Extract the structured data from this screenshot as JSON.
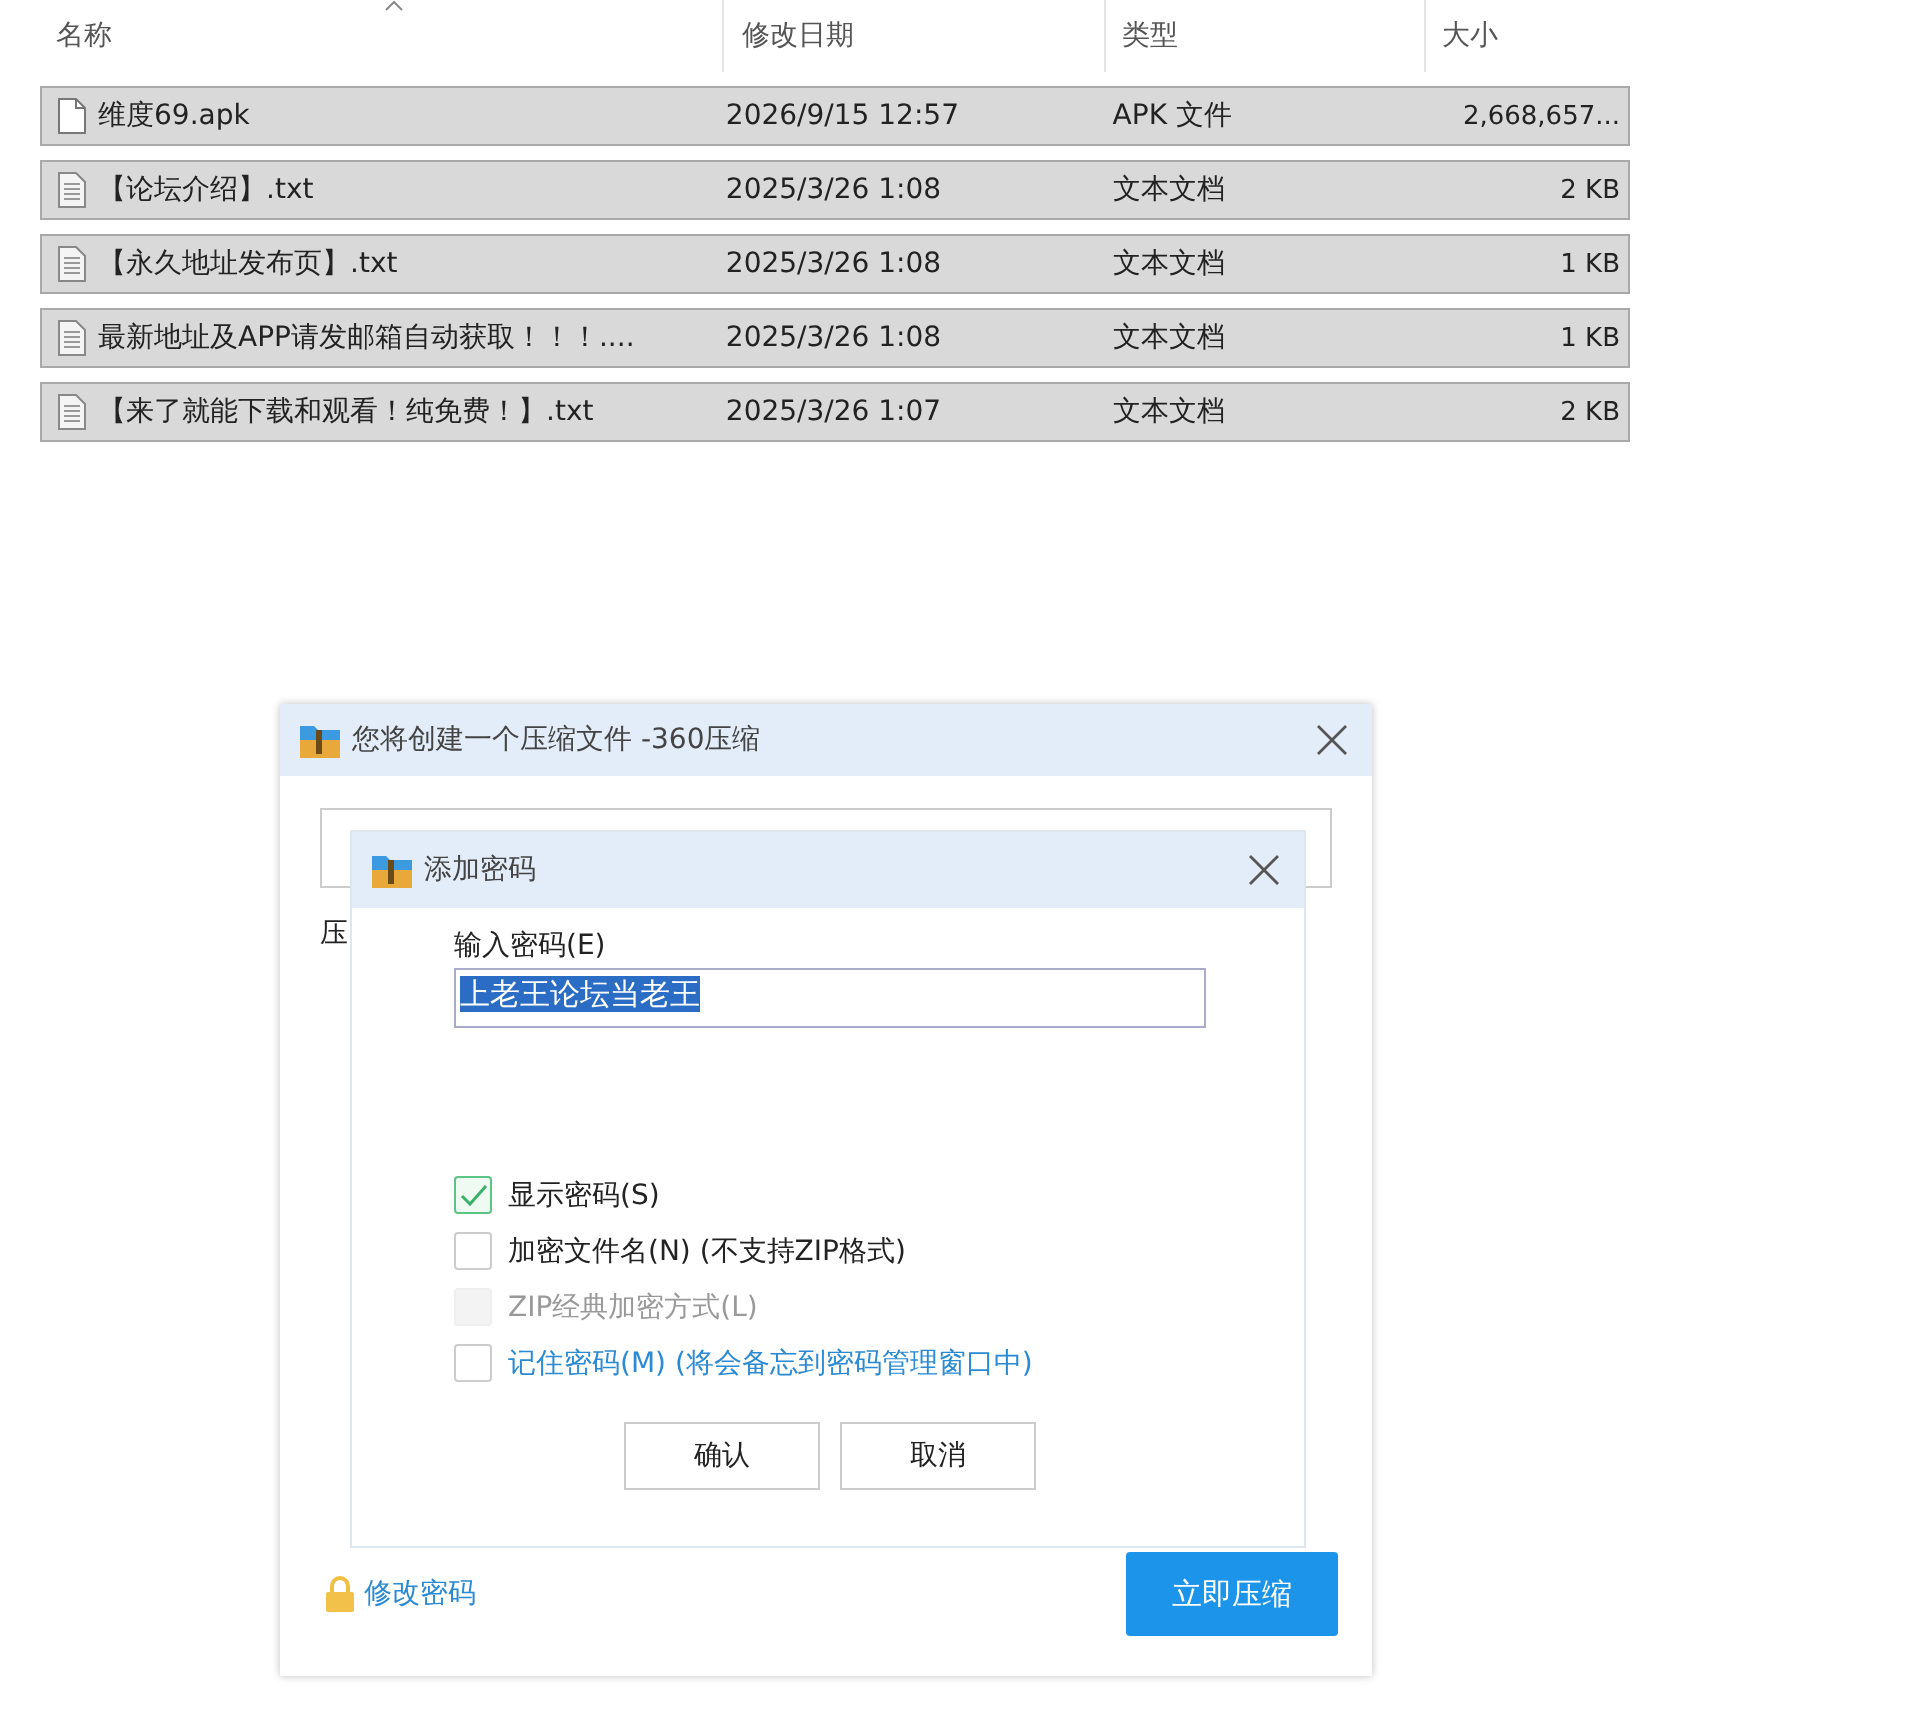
{
  "file_list": {
    "columns": [
      "名称",
      "修改日期",
      "类型",
      "大小"
    ],
    "rows": [
      {
        "kind": "apk",
        "name": "维度69.apk",
        "date": "2026/9/15 12:57",
        "type": "APK 文件",
        "size": "2,668,657...",
        "selected": true
      },
      {
        "kind": "txt",
        "name": "【论坛介绍】.txt",
        "date": "2025/3/26 1:08",
        "type": "文本文档",
        "size": "2 KB",
        "selected": true
      },
      {
        "kind": "txt",
        "name": "【永久地址发布页】.txt",
        "date": "2025/3/26 1:08",
        "type": "文本文档",
        "size": "1 KB",
        "selected": true
      },
      {
        "kind": "txt",
        "name": "最新地址及APP请发邮箱自动获取！！！....",
        "date": "2025/3/26 1:08",
        "type": "文本文档",
        "size": "1 KB",
        "selected": true
      },
      {
        "kind": "txt",
        "name": "【来了就能下载和观看！纯免费！】.txt",
        "date": "2025/3/26 1:07",
        "type": "文本文档",
        "size": "2 KB",
        "selected": true
      }
    ]
  },
  "outer_dialog": {
    "title": "您将创建一个压缩文件 -360压缩",
    "label_fragment": "压",
    "link": "修改密码",
    "primary_button": "立即压缩"
  },
  "password_dialog": {
    "title": "添加密码",
    "field_label": "输入密码(E)",
    "value": "上老王论坛当老王",
    "options": [
      {
        "kind": "plain",
        "label": "显示密码(S)",
        "checked": true,
        "disabled": false
      },
      {
        "kind": "plain",
        "label": "加密文件名(N) (不支持ZIP格式)",
        "checked": false,
        "disabled": false
      },
      {
        "kind": "plain",
        "label": "ZIP经典加密方式(L)",
        "checked": false,
        "disabled": true
      },
      {
        "kind": "link",
        "label": "记住密码(M) (将会备忘到密码管理窗口中)",
        "checked": false,
        "disabled": false
      }
    ],
    "buttons": [
      "确认",
      "取消"
    ]
  }
}
